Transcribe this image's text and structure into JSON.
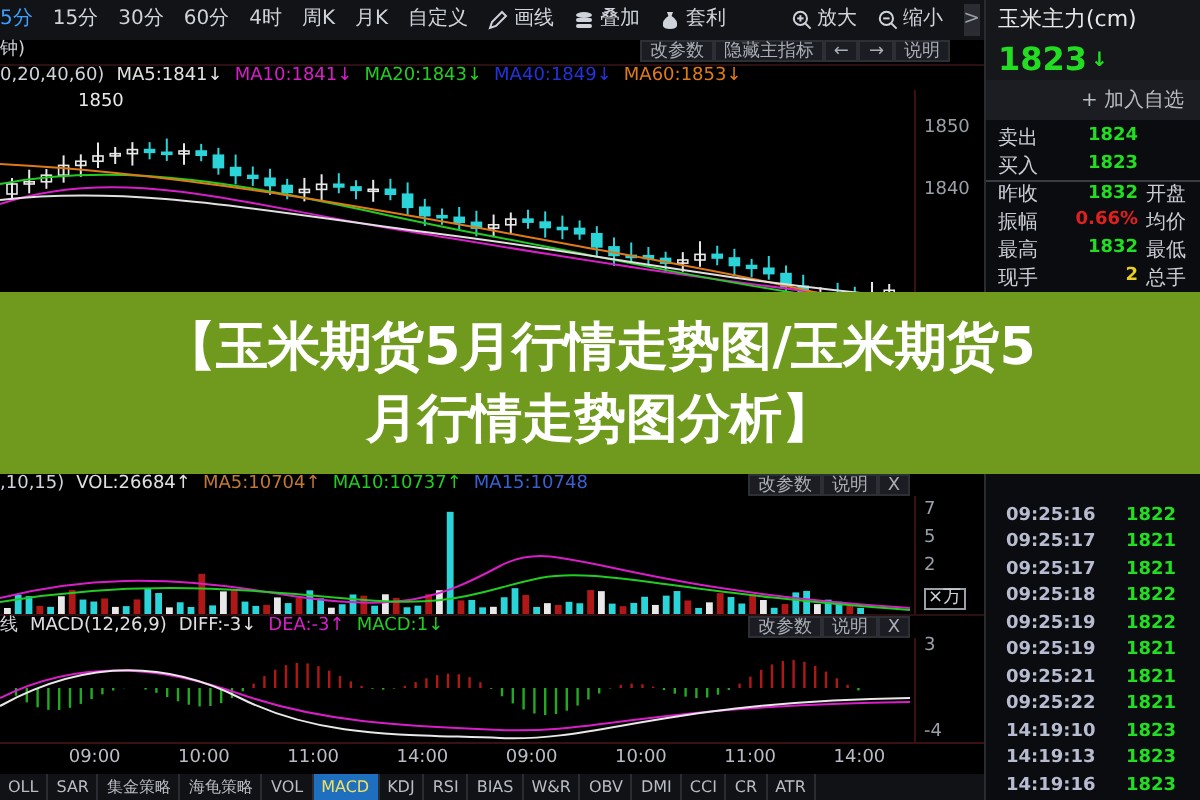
{
  "toolbar": {
    "periods": [
      {
        "label": "5分",
        "selected": true
      },
      {
        "label": "15分",
        "selected": false
      },
      {
        "label": "30分",
        "selected": false
      },
      {
        "label": "60分",
        "selected": false
      },
      {
        "label": "4时",
        "selected": false
      },
      {
        "label": "周K",
        "selected": false
      },
      {
        "label": "月K",
        "selected": false
      },
      {
        "label": "自定义",
        "selected": false
      }
    ],
    "tools": [
      {
        "label": "画线",
        "kind": "pencil"
      },
      {
        "label": "叠加",
        "kind": "stack"
      },
      {
        "label": "套利",
        "kind": "bag"
      }
    ],
    "zoom_tools": [
      {
        "label": "放大",
        "kind": "zoom-in"
      },
      {
        "label": "缩小",
        "kind": "zoom-out"
      }
    ],
    "collapse_button": ">"
  },
  "main_chart": {
    "subtitle": "钟)",
    "buttons": [
      "改参数",
      "隐藏主指标",
      "←",
      "→",
      "说明"
    ],
    "params": "0,20,40,60)",
    "ma": [
      {
        "label": "MA5:1841↓",
        "color": "#e0e0e0"
      },
      {
        "label": "MA10:1841↓",
        "color": "#d81ec8"
      },
      {
        "label": "MA20:1843↓",
        "color": "#22cc22"
      },
      {
        "label": "MA40:1849↓",
        "color": "#2233dd"
      },
      {
        "label": "MA60:1853↓",
        "color": "#e07a18"
      }
    ],
    "peak_label": "1850",
    "axis_labels": [
      "1850",
      "1840"
    ]
  },
  "volume_panel": {
    "params": ",10,15)",
    "items": [
      {
        "label": "VOL:26684↑",
        "color": "#e0e0e0"
      },
      {
        "label": "MA5:10704↑",
        "color": "#c07838"
      },
      {
        "label": "MA10:10737↑",
        "color": "#22cc22"
      },
      {
        "label": "MA15:10748",
        "color": "#3a5fd0"
      }
    ],
    "buttons": [
      "改参数",
      "说明",
      "X"
    ],
    "axis_labels": [
      "7",
      "5",
      "2"
    ],
    "unit": "×万"
  },
  "macd_panel": {
    "prefix": "线",
    "items": [
      {
        "label": "MACD(12,26,9)",
        "color": "#e0e0e0"
      },
      {
        "label": "DIFF:-3↓",
        "color": "#e0e0e0"
      },
      {
        "label": "DEA:-3↑",
        "color": "#d81ec8"
      },
      {
        "label": "MACD:1↓",
        "color": "#22cc22"
      }
    ],
    "buttons": [
      "改参数",
      "说明",
      "X"
    ],
    "axis_labels": [
      "3",
      "-4"
    ]
  },
  "time_axis": [
    "09:00",
    "10:00",
    "11:00",
    "14:00",
    "09:00",
    "10:00",
    "11:00",
    "14:00"
  ],
  "indicator_tabs": [
    {
      "label": "OLL",
      "selected": false
    },
    {
      "label": "SAR",
      "selected": false
    },
    {
      "label": "集金策略",
      "selected": false
    },
    {
      "label": "海龟策略",
      "selected": false
    },
    {
      "label": "VOL",
      "selected": false
    },
    {
      "label": "MACD",
      "selected": true
    },
    {
      "label": "KDJ",
      "selected": false
    },
    {
      "label": "RSI",
      "selected": false
    },
    {
      "label": "BIAS",
      "selected": false
    },
    {
      "label": "W&R",
      "selected": false
    },
    {
      "label": "OBV",
      "selected": false
    },
    {
      "label": "DMI",
      "selected": false
    },
    {
      "label": "CCI",
      "selected": false
    },
    {
      "label": "CR",
      "selected": false
    },
    {
      "label": "ATR",
      "selected": false
    }
  ],
  "quote": {
    "title": "玉米主力(cm)",
    "price": "1823",
    "trend_arrow": "↓",
    "add_button": "+ 加入自选",
    "stats": [
      {
        "label": "卖出",
        "value": "1824",
        "color": "#22dd22"
      },
      {
        "label": "买入",
        "value": "1823",
        "color": "#22dd22"
      },
      {
        "label": "昨收",
        "value": "1832",
        "color": "#22dd22",
        "side_label": "开盘"
      },
      {
        "label": "振幅",
        "value": "0.66%",
        "color": "#e02020",
        "side_label": "均价"
      },
      {
        "label": "最高",
        "value": "1832",
        "color": "#22dd22",
        "side_label": "最低"
      },
      {
        "label": "现手",
        "value": "2",
        "color": "#e8d020",
        "side_label": "总手"
      }
    ],
    "ticks": [
      {
        "time": "09:25:16",
        "price": "1822"
      },
      {
        "time": "09:25:17",
        "price": "1821"
      },
      {
        "time": "09:25:17",
        "price": "1821"
      },
      {
        "time": "09:25:18",
        "price": "1822"
      },
      {
        "time": "09:25:19",
        "price": "1822"
      },
      {
        "time": "09:25:19",
        "price": "1821"
      },
      {
        "time": "09:25:21",
        "price": "1821"
      },
      {
        "time": "09:25:22",
        "price": "1821"
      },
      {
        "time": "14:19:10",
        "price": "1823"
      },
      {
        "time": "14:19:13",
        "price": "1823"
      },
      {
        "time": "14:19:16",
        "price": "1823"
      }
    ]
  },
  "banner": {
    "text": "【玉米期货5月行情走势图/玉米期货5月行情走势图分析】"
  }
}
